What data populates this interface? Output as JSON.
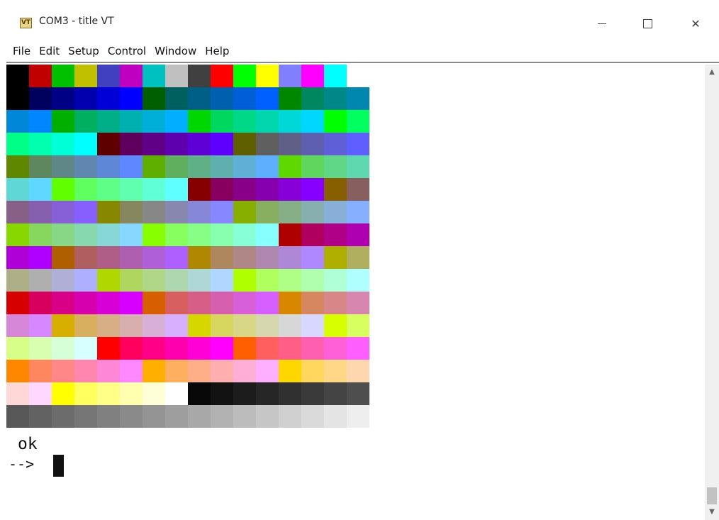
{
  "window": {
    "title": "COM3 - title VT",
    "icon_text": "VT",
    "icon": "teraterm-vt-icon",
    "controls": {
      "minimize_icon": "minimize-icon",
      "maximize_icon": "maximize-icon",
      "close_icon": "close-icon",
      "close_glyph": "✕"
    }
  },
  "menu": {
    "items": [
      "File",
      "Edit",
      "Setup",
      "Control",
      "Window",
      "Help"
    ]
  },
  "terminal": {
    "background": "#ffffff",
    "foreground": "#111111",
    "color_rows": [
      [
        "#000000",
        "#c00000",
        "#00c000",
        "#c0c000",
        "#4040c0",
        "#c000c0",
        "#00c0c0",
        "#c0c0c0",
        "#404040",
        "#ff0000",
        "#00ff00",
        "#ffff00",
        "#8080ff",
        "#ff00ff",
        "#00ffff",
        "#ffffff"
      ],
      [
        "#000000",
        "#00005f",
        "#000087",
        "#0000af",
        "#0000d7",
        "#0000ff",
        "#005f00",
        "#005f5f",
        "#005f87",
        "#005faf",
        "#005fd7",
        "#005fff",
        "#008700",
        "#00875f",
        "#008787",
        "#0087af"
      ],
      [
        "#0087d7",
        "#0087ff",
        "#00af00",
        "#00af5f",
        "#00af87",
        "#00afaf",
        "#00afd7",
        "#00afff",
        "#00d700",
        "#00d75f",
        "#00d787",
        "#00d7af",
        "#00d7d7",
        "#00d7ff",
        "#00ff00",
        "#00ff5f"
      ],
      [
        "#00ff87",
        "#00ffaf",
        "#00ffd7",
        "#00ffff",
        "#5f0000",
        "#5f005f",
        "#5f0087",
        "#5f00af",
        "#5f00d7",
        "#5f00ff",
        "#5f5f00",
        "#5f5f5f",
        "#5f5f87",
        "#5f5faf",
        "#5f5fd7",
        "#5f5fff"
      ],
      [
        "#5f8700",
        "#5f875f",
        "#5f8787",
        "#5f87af",
        "#5f87d7",
        "#5f87ff",
        "#5faf00",
        "#5faf5f",
        "#5faf87",
        "#5fafaf",
        "#5fafd7",
        "#5fafff",
        "#5fd700",
        "#5fd75f",
        "#5fd787",
        "#5fd7af"
      ],
      [
        "#5fd7d7",
        "#5fd7ff",
        "#5fff00",
        "#5fff5f",
        "#5fff87",
        "#5fffaf",
        "#5fffd7",
        "#5fffff",
        "#870000",
        "#87005f",
        "#870087",
        "#8700af",
        "#8700d7",
        "#8700ff",
        "#875f00",
        "#875f5f"
      ],
      [
        "#875f87",
        "#875faf",
        "#875fd7",
        "#875fff",
        "#878700",
        "#87875f",
        "#878787",
        "#8787af",
        "#8787d7",
        "#8787ff",
        "#87af00",
        "#87af5f",
        "#87af87",
        "#87afaf",
        "#87afd7",
        "#87afff"
      ],
      [
        "#87d700",
        "#87d75f",
        "#87d787",
        "#87d7af",
        "#87d7d7",
        "#87d7ff",
        "#87ff00",
        "#87ff5f",
        "#87ff87",
        "#87ffaf",
        "#87ffd7",
        "#87ffff",
        "#af0000",
        "#af005f",
        "#af0087",
        "#af00af"
      ],
      [
        "#af00d7",
        "#af00ff",
        "#af5f00",
        "#af5f5f",
        "#af5f87",
        "#af5faf",
        "#af5fd7",
        "#af5fff",
        "#af8700",
        "#af875f",
        "#af8787",
        "#af87af",
        "#af87d7",
        "#af87ff",
        "#afaf00",
        "#afaf5f"
      ],
      [
        "#afaf87",
        "#afafaf",
        "#afafd7",
        "#afafff",
        "#afd700",
        "#afd75f",
        "#afd787",
        "#afd7af",
        "#afd7d7",
        "#afd7ff",
        "#afff00",
        "#afff5f",
        "#afff87",
        "#afffaf",
        "#afffd7",
        "#afffff"
      ],
      [
        "#d70000",
        "#d7005f",
        "#d70087",
        "#d700af",
        "#d700d7",
        "#d700ff",
        "#d75f00",
        "#d75f5f",
        "#d75f87",
        "#d75faf",
        "#d75fd7",
        "#d75fff",
        "#d78700",
        "#d7875f",
        "#d78787",
        "#d787af"
      ],
      [
        "#d787d7",
        "#d787ff",
        "#d7af00",
        "#d7af5f",
        "#d7af87",
        "#d7afaf",
        "#d7afd7",
        "#d7afff",
        "#d7d700",
        "#d7d75f",
        "#d7d787",
        "#d7d7af",
        "#d7d7d7",
        "#d7d7ff",
        "#d7ff00",
        "#d7ff5f"
      ],
      [
        "#d7ff87",
        "#d7ffaf",
        "#d7ffd7",
        "#d7ffff",
        "#ff0000",
        "#ff005f",
        "#ff0087",
        "#ff00af",
        "#ff00d7",
        "#ff00ff",
        "#ff5f00",
        "#ff5f5f",
        "#ff5f87",
        "#ff5faf",
        "#ff5fd7",
        "#ff5fff"
      ],
      [
        "#ff8700",
        "#ff875f",
        "#ff8787",
        "#ff87af",
        "#ff87d7",
        "#ff87ff",
        "#ffaf00",
        "#ffaf5f",
        "#ffaf87",
        "#ffafaf",
        "#ffafd7",
        "#ffafff",
        "#ffd700",
        "#ffd75f",
        "#ffd787",
        "#ffd7af"
      ],
      [
        "#ffd7d7",
        "#ffd7ff",
        "#ffff00",
        "#ffff5f",
        "#ffff87",
        "#ffffaf",
        "#ffffd7",
        "#ffffff",
        "#080808",
        "#121212",
        "#1c1c1c",
        "#262626",
        "#303030",
        "#3a3a3a",
        "#444444",
        "#4e4e4e"
      ],
      [
        "#585858",
        "#626262",
        "#6c6c6c",
        "#767676",
        "#808080",
        "#8a8a8a",
        "#949494",
        "#9e9e9e",
        "#a8a8a8",
        "#b2b2b2",
        "#bcbcbc",
        "#c6c6c6",
        "#d0d0d0",
        "#dadada",
        "#e4e4e4",
        "#eeeeee"
      ]
    ],
    "output_line": "ok",
    "prompt": "-->"
  },
  "scrollbar": {
    "up_icon": "scroll-up-arrow-icon",
    "down_icon": "scroll-down-arrow-icon"
  }
}
